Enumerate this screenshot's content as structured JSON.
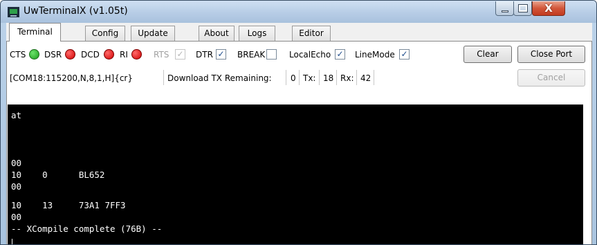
{
  "window": {
    "title": "UwTerminalX (v1.05t)",
    "icon": "terminal-app-icon"
  },
  "tabs": [
    {
      "label": "Terminal",
      "active": true
    },
    {
      "label": "Config"
    },
    {
      "label": "Update"
    },
    {
      "label": "About"
    },
    {
      "label": "Logs"
    },
    {
      "label": "Editor"
    }
  ],
  "signals": {
    "cts": {
      "label": "CTS",
      "state": "green"
    },
    "dsr": {
      "label": "DSR",
      "state": "red"
    },
    "dcd": {
      "label": "DCD",
      "state": "red"
    },
    "ri": {
      "label": "RI",
      "state": "red"
    }
  },
  "checkboxes": {
    "rts": {
      "label": "RTS",
      "checked": true,
      "enabled": false
    },
    "dtr": {
      "label": "DTR",
      "checked": true
    },
    "break": {
      "label": "BREAK",
      "checked": false
    },
    "local_echo": {
      "label": "LocalEcho",
      "checked": true
    },
    "line_mode": {
      "label": "LineMode",
      "checked": true
    }
  },
  "buttons": {
    "clear": "Clear",
    "close_port": "Close Port",
    "cancel": "Cancel"
  },
  "status": {
    "port_settings": "[COM18:115200,N,8,1,H]{cr}",
    "download_label": "Download TX Remaining:",
    "download_value": "0",
    "tx_label": "Tx:",
    "tx_value": "18",
    "rx_label": "Rx:",
    "rx_value": "42"
  },
  "check_mark": "✓",
  "terminal_lines": [
    "at",
    "",
    "00",
    "10    0      BL652",
    "00",
    "10    13     73A1 7FF3",
    "00",
    "-- XCompile complete (76B) --"
  ],
  "colors": {
    "terminal_bg": "#000000",
    "terminal_fg": "#ffffff",
    "led_green": "#22aa22",
    "led_red": "#dd0000"
  }
}
